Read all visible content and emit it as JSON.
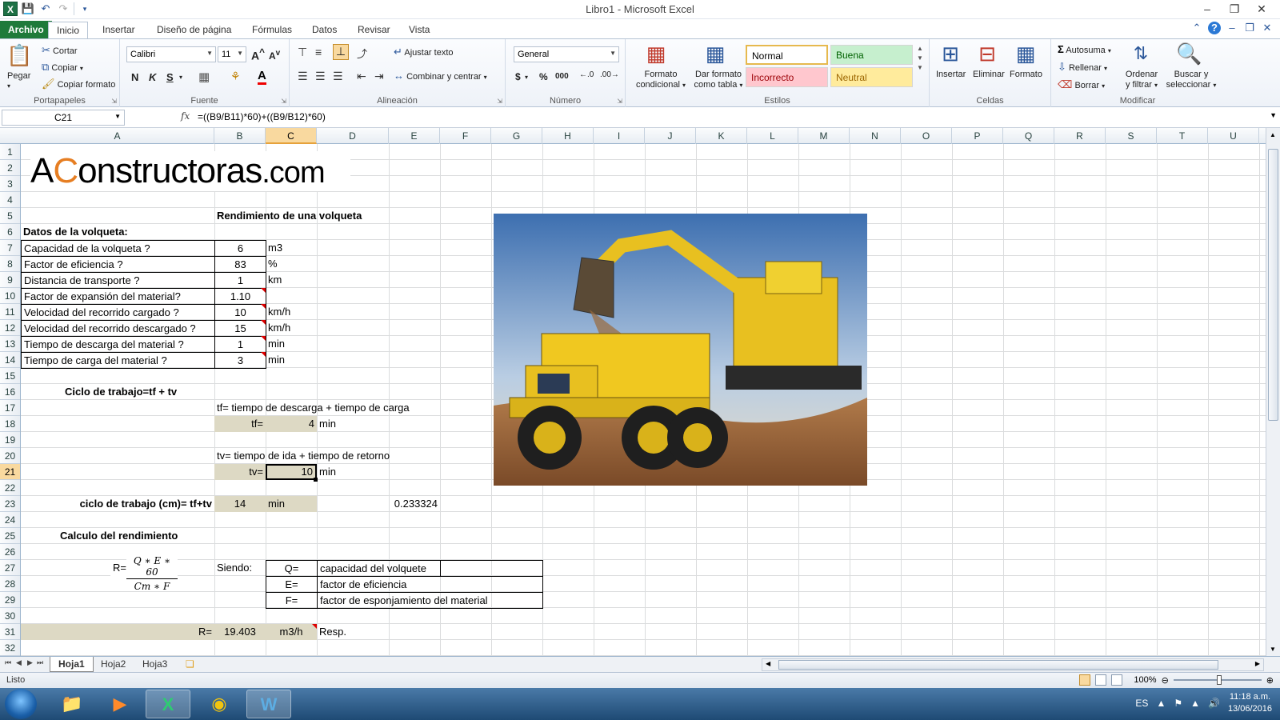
{
  "window": {
    "title": "Libro1  -  Microsoft Excel"
  },
  "ribbon_tabs": [
    "Archivo",
    "Inicio",
    "Insertar",
    "Diseño de página",
    "Fórmulas",
    "Datos",
    "Revisar",
    "Vista"
  ],
  "ribbon": {
    "clipboard": {
      "label": "Portapapeles",
      "paste": "Pegar",
      "cut": "Cortar",
      "copy": "Copiar",
      "copy_format": "Copiar formato"
    },
    "font": {
      "label": "Fuente",
      "family": "Calibri",
      "size": "11",
      "bold": "N",
      "italic": "K",
      "underline": "S"
    },
    "alignment": {
      "label": "Alineación",
      "wrap": "Ajustar texto",
      "merge": "Combinar y centrar"
    },
    "number": {
      "label": "Número",
      "format": "General",
      "currency": "$",
      "percent": "%",
      "thousands": "000"
    },
    "styles": {
      "label": "Estilos",
      "cond_format_1": "Formato",
      "cond_format_2": "condicional",
      "table_format_1": "Dar formato",
      "table_format_2": "como tabla",
      "normal": "Normal",
      "buena": "Buena",
      "incorrecto": "Incorrecto",
      "neutral": "Neutral"
    },
    "cells": {
      "label": "Celdas",
      "insert": "Insertar",
      "delete": "Eliminar",
      "format": "Formato"
    },
    "editing": {
      "label": "Modificar",
      "autosum": "Autosuma",
      "fill": "Rellenar",
      "clear": "Borrar",
      "sort_1": "Ordenar",
      "sort_2": "y filtrar",
      "find_1": "Buscar y",
      "find_2": "seleccionar"
    }
  },
  "formula_bar": {
    "name_box": "C21",
    "fx": "fx",
    "formula": "=((B9/B11)*60)+((B9/B12)*60)"
  },
  "columns": [
    "A",
    "B",
    "C",
    "D",
    "E",
    "F",
    "G",
    "H",
    "I",
    "J",
    "K",
    "L",
    "M",
    "N",
    "O",
    "P",
    "Q",
    "R",
    "S",
    "T",
    "U"
  ],
  "rows": [
    "1",
    "2",
    "3",
    "4",
    "5",
    "6",
    "7",
    "8",
    "9",
    "10",
    "11",
    "12",
    "13",
    "14",
    "15",
    "16",
    "17",
    "18",
    "19",
    "20",
    "21",
    "22",
    "23",
    "24",
    "25",
    "26",
    "27",
    "28",
    "29",
    "30",
    "31",
    "32"
  ],
  "sheet": {
    "logo": {
      "a": "A",
      "c": "C",
      "rest": "onstructoras",
      "dom": ".com"
    },
    "title": "Rendimiento de una volqueta",
    "datos_header": "Datos de la  volqueta:",
    "inputs": [
      {
        "label": "Capacidad de la volqueta ?",
        "value": "6",
        "unit": "m3"
      },
      {
        "label": "Factor de eficiencia ?",
        "value": "83",
        "unit": "%"
      },
      {
        "label": "Distancia de transporte ?",
        "value": "1",
        "unit": "km"
      },
      {
        "label": "Factor de expansión del material?",
        "value": "1.10",
        "unit": ""
      },
      {
        "label": "Velocidad del recorrido cargado ?",
        "value": "10",
        "unit": "km/h"
      },
      {
        "label": "Velocidad del recorrido descargado ?",
        "value": "15",
        "unit": "km/h"
      },
      {
        "label": "Tiempo de descarga del material ?",
        "value": "1",
        "unit": "min"
      },
      {
        "label": "Tiempo de carga del material ?",
        "value": "3",
        "unit": "min"
      }
    ],
    "ciclo_header": "Ciclo de trabajo=tf + tv",
    "tf_def": "tf= tiempo de descarga + tiempo de carga",
    "tf_label": "tf=",
    "tf_value": "4",
    "tf_unit": "min",
    "tv_def": "tv= tiempo de ida + tiempo de retorno",
    "tv_label": "tv=",
    "tv_value": "10",
    "tv_unit": "min",
    "cm_label": "ciclo de trabajo (cm)= tf+tv",
    "cm_value": "14",
    "cm_unit": "min",
    "e23_value": "0.233324",
    "calc_header": "Calculo del rendimiento",
    "formula_r": "R=",
    "formula_num": "Q ∗ E ∗ 60",
    "formula_den": "Cm ∗ F",
    "siendo": "Siendo:",
    "legend": [
      {
        "sym": "Q=",
        "desc": "capacidad del volquete"
      },
      {
        "sym": "E=",
        "desc": "factor de eficiencia"
      },
      {
        "sym": "F=",
        "desc": "factor de esponjamiento del material"
      }
    ],
    "r_label": "R=",
    "r_value": "19.403",
    "r_unit": "m3/h",
    "resp": "Resp."
  },
  "sheet_tabs": [
    "Hoja1",
    "Hoja2",
    "Hoja3"
  ],
  "status": {
    "ready": "Listo",
    "zoom": "100%"
  },
  "taskbar": {
    "lang": "ES",
    "time": "11:18 a.m.",
    "date": "13/06/2016"
  }
}
